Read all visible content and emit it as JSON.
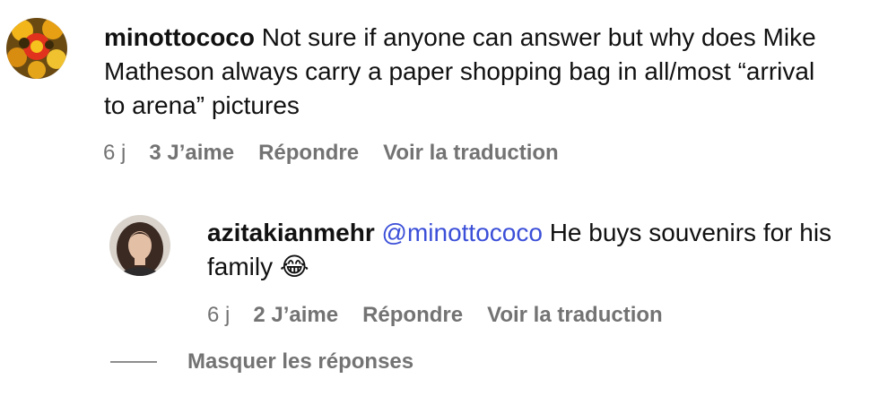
{
  "comment": {
    "username": "minottococo",
    "text": "Not sure if anyone can answer but why does Mike Matheson always carry a paper shopping bag in all/most “arrival to arena” pictures",
    "time": "6 j",
    "likes": "3 J’aime",
    "reply_label": "Répondre",
    "translate_label": "Voir la traduction",
    "avatar_icon": "flower-avatar-icon"
  },
  "reply": {
    "username": "azitakianmehr",
    "mention": "@minottococo",
    "text": "He buys souvenirs for his family",
    "emoji": "😂",
    "time": "6 j",
    "likes": "2 J’aime",
    "reply_label": "Répondre",
    "translate_label": "Voir la traduction",
    "avatar_icon": "person-avatar-icon"
  },
  "thread": {
    "hide_replies_label": "Masquer les réponses"
  },
  "colors": {
    "mention": "#3b4fd8",
    "meta": "#737373",
    "text": "#111111"
  }
}
